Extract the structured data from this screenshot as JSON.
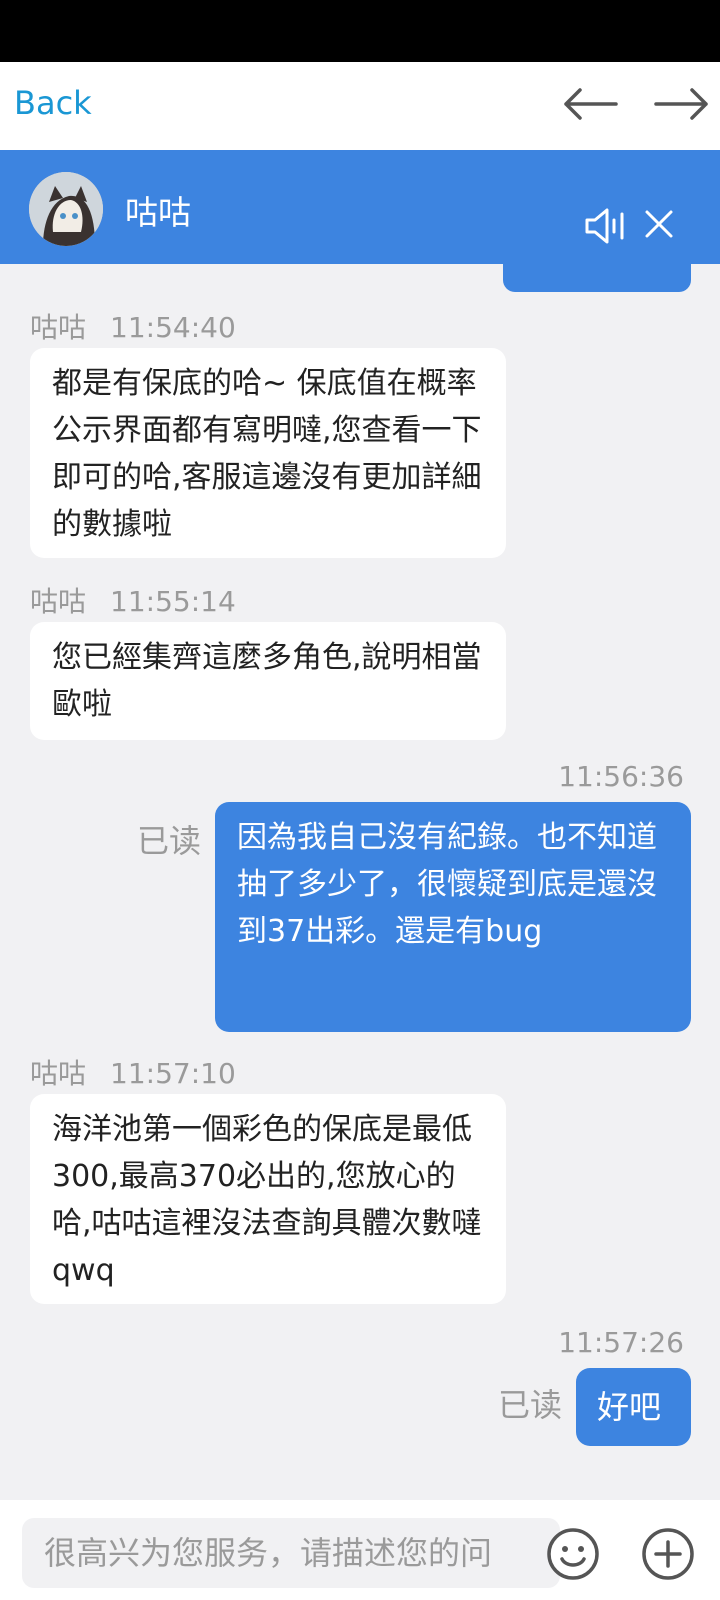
{
  "nav": {
    "back_label": "Back"
  },
  "header": {
    "name": "咕咕"
  },
  "messages": [
    {
      "sender": "咕咕",
      "time": "11:54:40",
      "text": "都是有保底的哈~ 保底值在概率公示界面都有寫明噠,您查看一下即可的哈,客服這邊沒有更加詳細的數據啦"
    },
    {
      "sender": "咕咕",
      "time": "11:55:14",
      "text": "您已經集齊這麼多角色,說明相當歐啦"
    },
    {
      "time": "11:56:36",
      "status": "已读",
      "text": "因為我自己沒有紀錄。也不知道抽了多少了，很懷疑到底是還沒到37出彩。還是有bug"
    },
    {
      "sender": "咕咕",
      "time": "11:57:10",
      "text": "海洋池第一個彩色的保底是最低300,最高370必出的,您放心的哈,咕咕這裡沒法查詢具體次數噠qwq"
    },
    {
      "time": "11:57:26",
      "status": "已读",
      "text": "好吧"
    }
  ],
  "input": {
    "placeholder": "很高兴为您服务，请描述您的问"
  },
  "colors": {
    "accent": "#3d84e0",
    "link": "#1a97d4",
    "background": "#f1f1f3"
  },
  "icons": [
    "arrow-left-icon",
    "arrow-right-icon",
    "speaker-icon",
    "close-icon",
    "emoji-icon",
    "plus-icon"
  ]
}
